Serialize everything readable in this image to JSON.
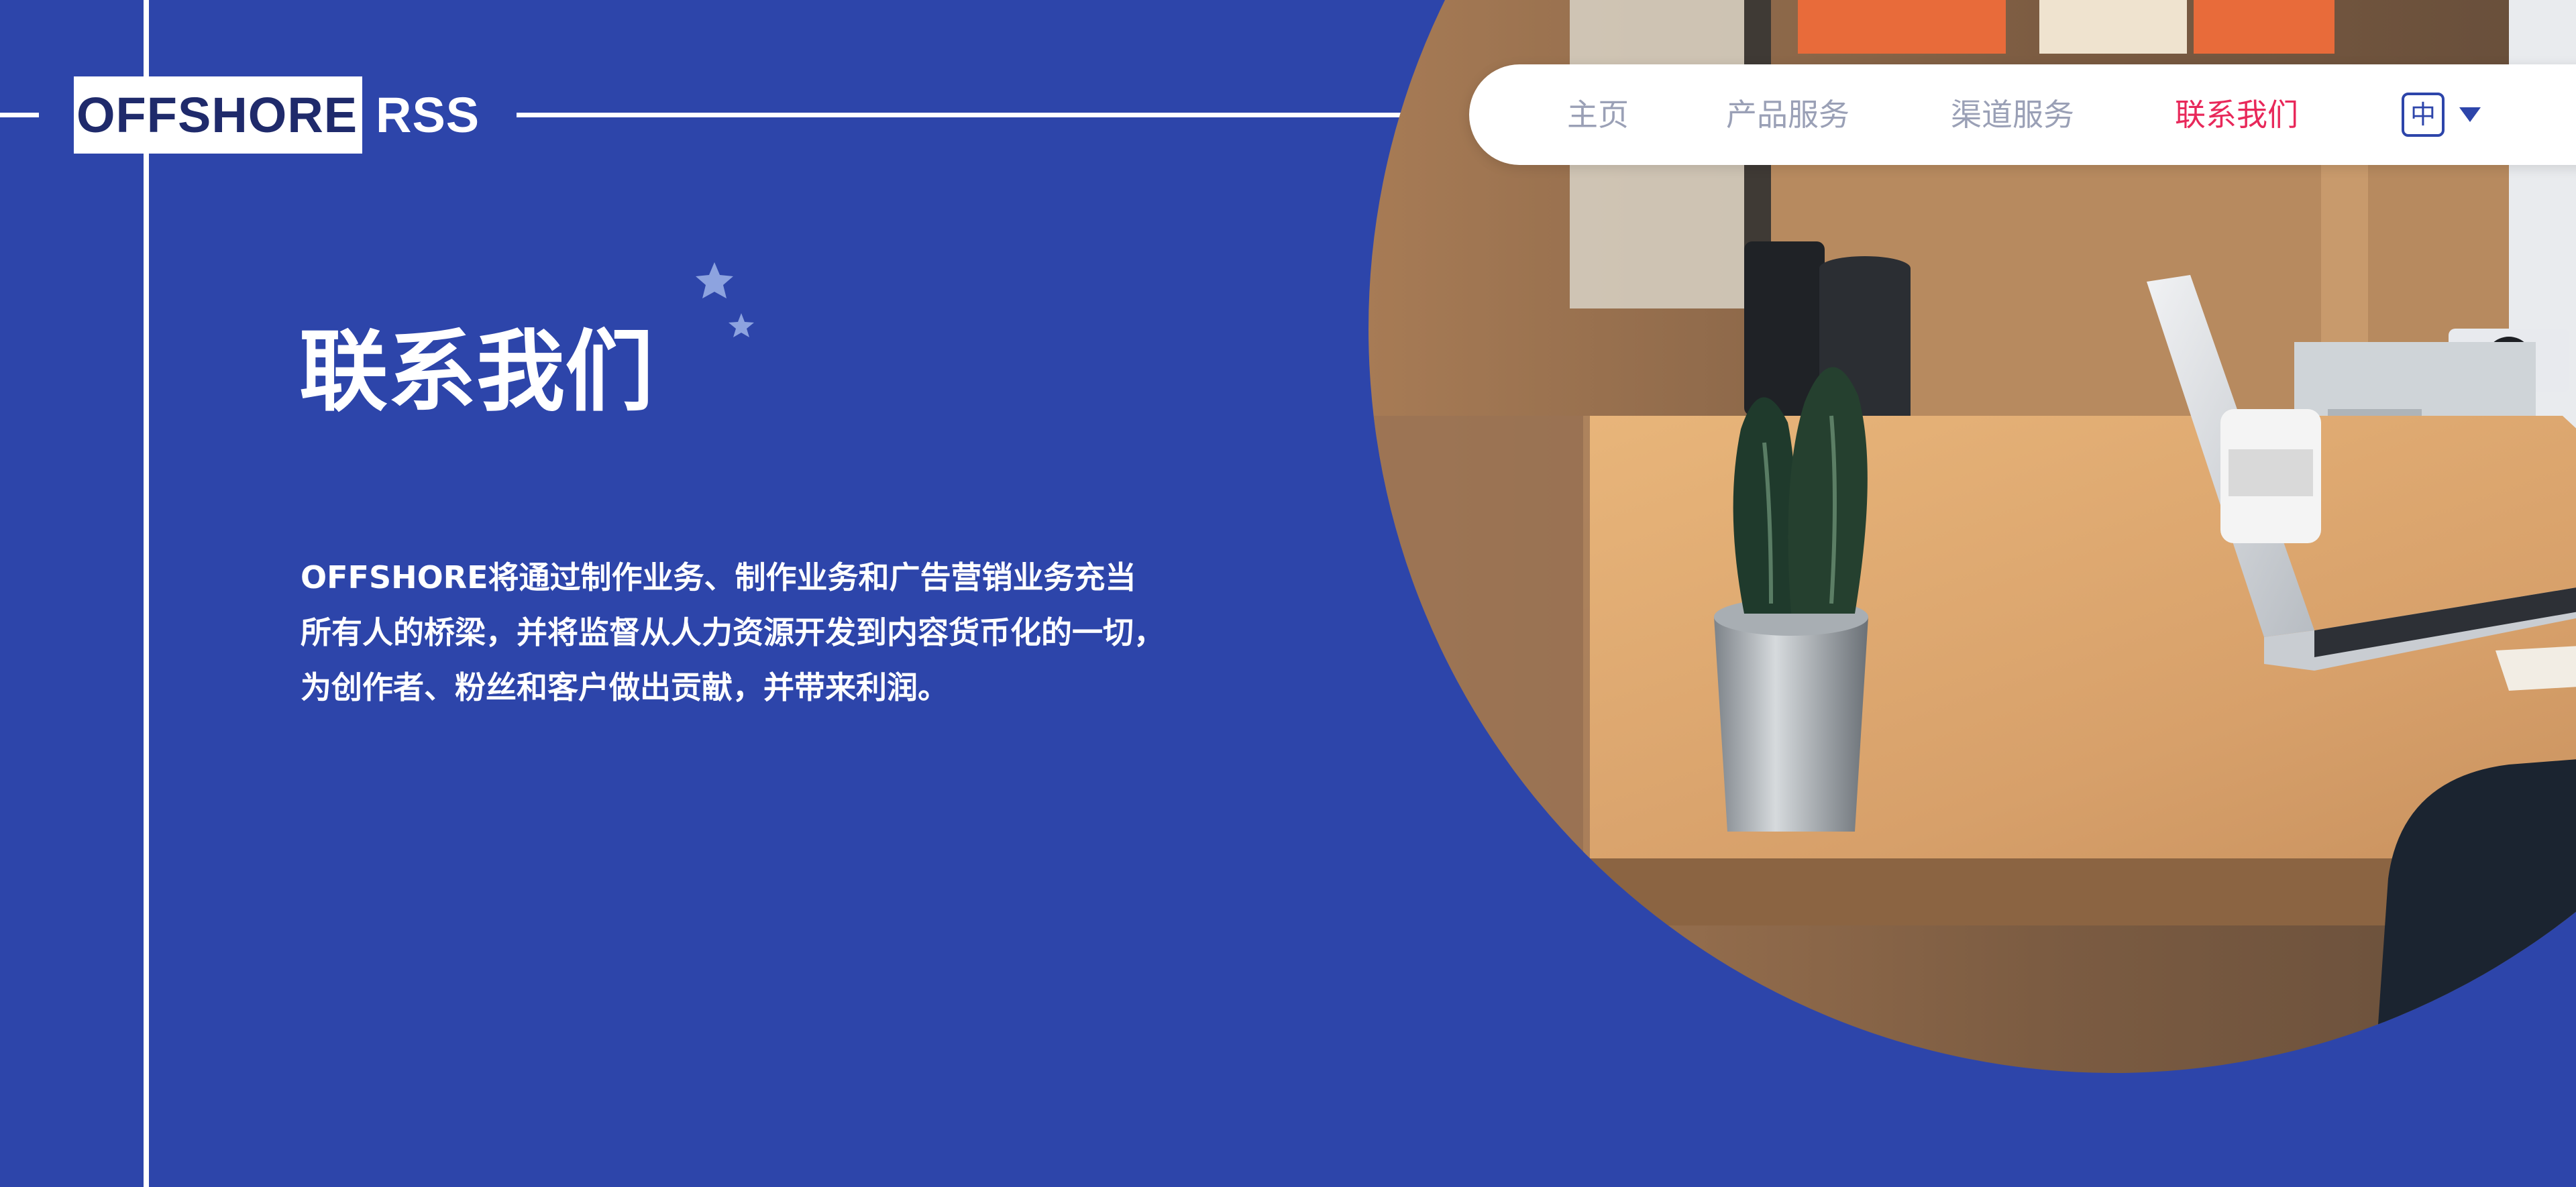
{
  "logo": {
    "boxed_text": "OFFSHORE",
    "rest_text": "RSS"
  },
  "nav": {
    "items": [
      {
        "label": "主页",
        "active": false
      },
      {
        "label": "产品服务",
        "active": false
      },
      {
        "label": "渠道服务",
        "active": false
      },
      {
        "label": "联系我们",
        "active": true
      }
    ],
    "language": {
      "current": "中",
      "icon": "chevron-down-icon"
    }
  },
  "hero": {
    "title": "联系我们",
    "description": "OFFSHORE将通过制作业务、制作业务和广告营销业务充当所有人的桥梁，并将监督从人力资源开发到内容货币化的一切，为创作者、粉丝和客户做出贡献，并带来利润。",
    "decoration_icon": "stars-icon",
    "photo_icon": "office-desk-photo"
  },
  "colors": {
    "background": "#2d45aa",
    "accent_active": "#e8285a",
    "nav_inactive": "#9aa0b6",
    "logo_text": "#1f2a6b"
  }
}
